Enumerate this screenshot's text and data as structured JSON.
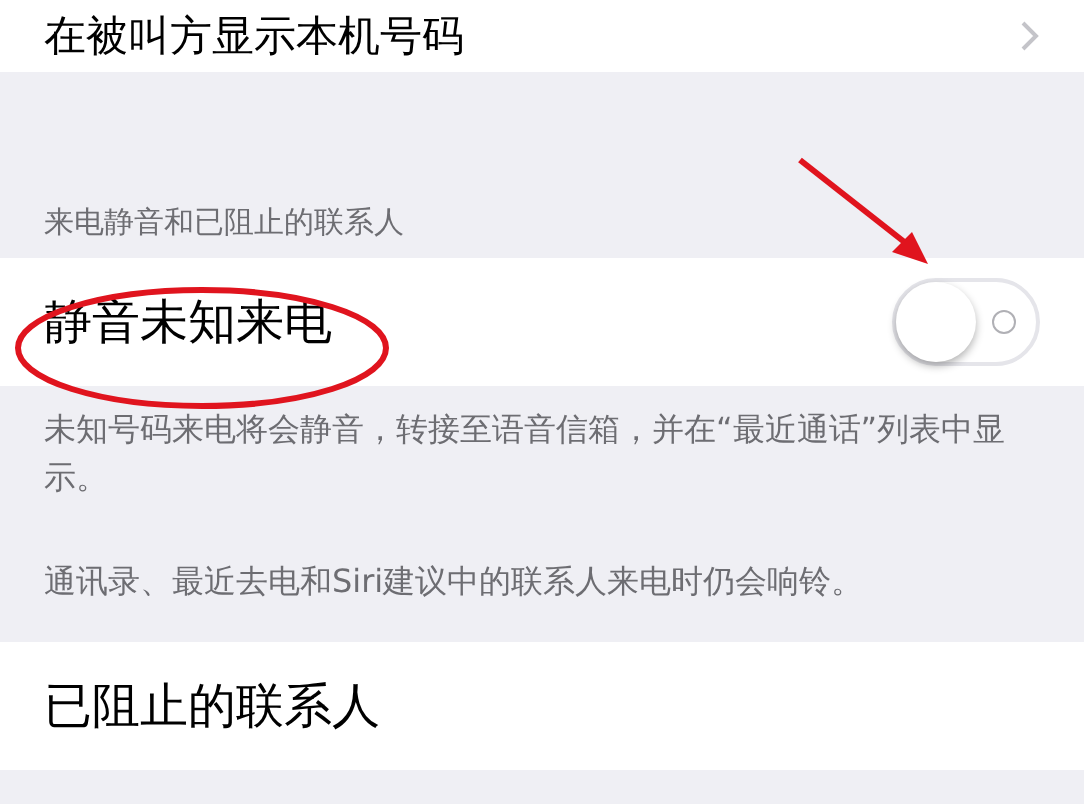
{
  "rows_top": [
    {
      "label": "在被叫方显示本机号码",
      "chevron": true
    }
  ],
  "section": {
    "header": "来电静音和已阻止的联系人",
    "toggle_row": {
      "label": "静音未知来电",
      "on": false
    },
    "footers": [
      "未知号码来电将会静音，转接至语音信箱，并在“最近通话”列表中显示。",
      "通讯录、最近去电和Siri建议中的联系人来电时仍会响铃。"
    ]
  },
  "rows_bottom": [
    {
      "label": "已阻止的联系人"
    }
  ],
  "annotations": [
    {
      "kind": "ellipse",
      "color": "#e0141e"
    },
    {
      "kind": "arrow",
      "color": "#e0141e"
    }
  ]
}
